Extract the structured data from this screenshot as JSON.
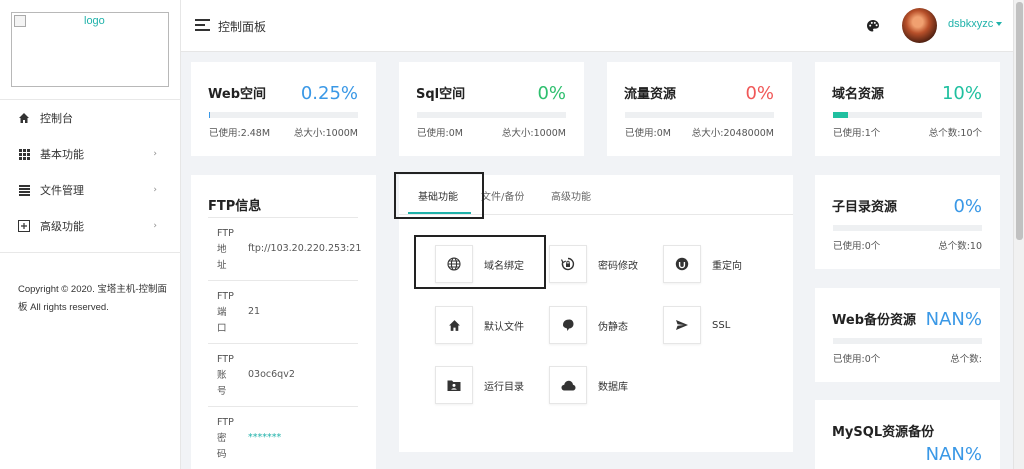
{
  "sidebar": {
    "logo_alt": "logo",
    "menu": [
      {
        "label": "控制台",
        "icon": "home-icon"
      },
      {
        "label": "基本功能",
        "icon": "grid-icon"
      },
      {
        "label": "文件管理",
        "icon": "list-icon"
      },
      {
        "label": "高级功能",
        "icon": "plus-square-icon"
      }
    ],
    "copyright": "Copyright © 2020. 宝塔主机-控制面板 All rights reserved."
  },
  "header": {
    "title": "控制面板",
    "username": "dsbkxyzc"
  },
  "stats": [
    {
      "title": "Web空间",
      "percent": "0.25%",
      "fill": 0.0025,
      "color": "#3a98e6",
      "used": "已使用:2.48M",
      "total": "总大小:1000M"
    },
    {
      "title": "Sql空间",
      "percent": "0%",
      "fill": 0,
      "color": "#2ebf6e",
      "used": "已使用:0M",
      "total": "总大小:1000M"
    },
    {
      "title": "流量资源",
      "percent": "0%",
      "fill": 0,
      "color": "#f05858",
      "used": "已使用:0M",
      "total": "总大小:2048000M"
    },
    {
      "title": "域名资源",
      "percent": "10%",
      "fill": 0.1,
      "color": "#20c0a0",
      "used": "已使用:1个",
      "total": "总个数:10个"
    }
  ],
  "ftp": {
    "title": "FTP信息",
    "rows": [
      {
        "label": "FTP地址",
        "value": "ftp://103.20.220.253:21"
      },
      {
        "label": "FTP端口",
        "value": "21"
      },
      {
        "label": "FTP账号",
        "value": "03oc6qv2"
      },
      {
        "label": "FTP密码",
        "value": "*******"
      }
    ]
  },
  "features": {
    "tabs": [
      "基础功能",
      "文件/备份",
      "高级功能"
    ],
    "items": [
      {
        "label": "域名绑定",
        "icon": "globe-icon"
      },
      {
        "label": "密码修改",
        "icon": "lock-reset-icon"
      },
      {
        "label": "重定向",
        "icon": "redirect-icon"
      },
      {
        "label": "默认文件",
        "icon": "home-icon"
      },
      {
        "label": "伪静态",
        "icon": "leaf-icon"
      },
      {
        "label": "SSL",
        "icon": "send-icon"
      },
      {
        "label": "运行目录",
        "icon": "folder-user-icon"
      },
      {
        "label": "数据库",
        "icon": "cloud-icon"
      }
    ]
  },
  "right": {
    "subdir": {
      "title": "子目录资源",
      "percent": "0%",
      "fill": 0,
      "color": "#3a98e6",
      "used": "已使用:0个",
      "total": "总个数:10"
    },
    "webbak": {
      "title": "Web备份资源",
      "percent": "NAN%",
      "fill": 0,
      "color": "#3a98e6",
      "used": "已使用:0个",
      "total": "总个数:"
    },
    "mysqlbak": {
      "title": "MySQL资源备份",
      "percent": "NAN%",
      "color": "#3a98e6"
    }
  }
}
